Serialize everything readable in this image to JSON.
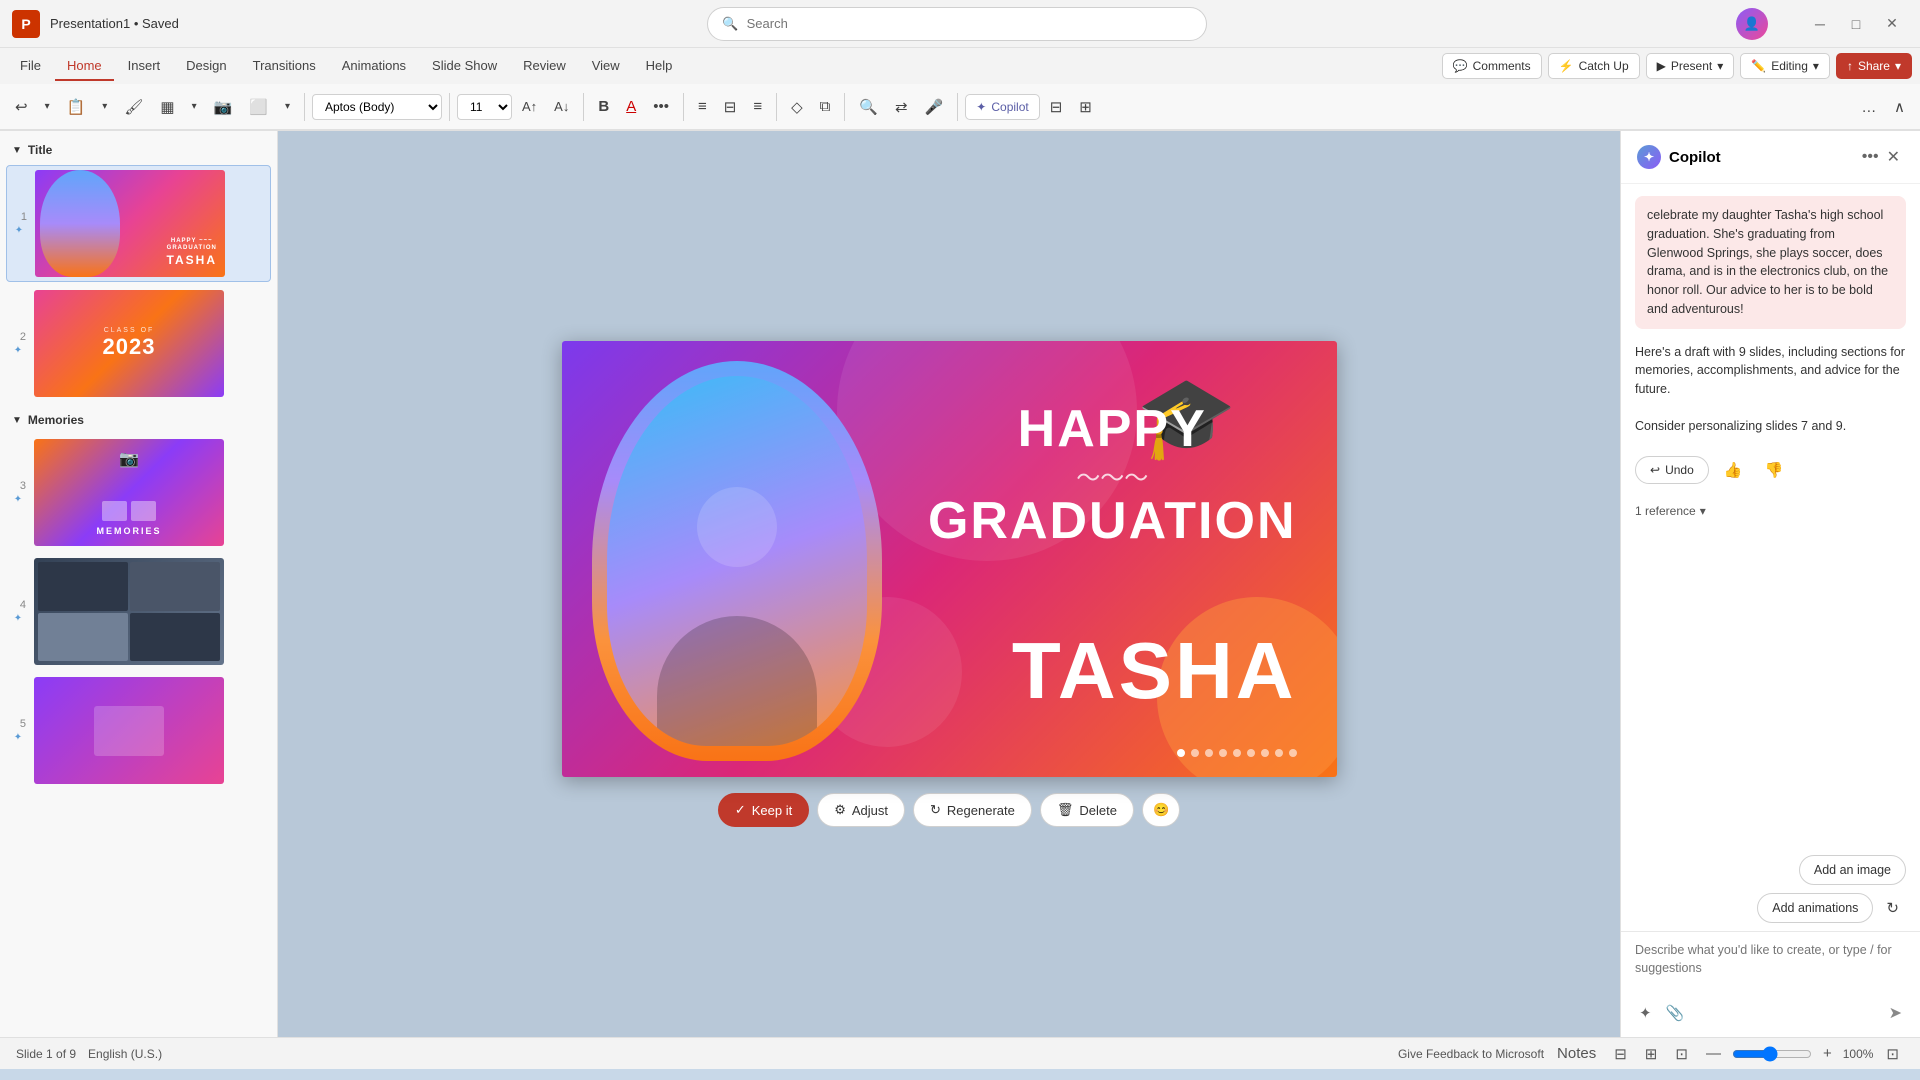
{
  "titlebar": {
    "logo": "P",
    "title": "Presentation1 • Saved",
    "search_placeholder": "Search"
  },
  "ribbon": {
    "tabs": [
      "File",
      "Home",
      "Insert",
      "Design",
      "Transitions",
      "Animations",
      "Slide Show",
      "Review",
      "View",
      "Help"
    ],
    "active_tab": "Home",
    "actions": {
      "comments": "Comments",
      "catch_up": "Catch Up",
      "present": "Present",
      "editing": "Editing",
      "share": "Share",
      "copilot": "Copilot"
    },
    "toolbar": {
      "font": "Aptos (Body)",
      "font_size": "11",
      "bold": "B",
      "more": "..."
    }
  },
  "slide_panel": {
    "sections": [
      {
        "name": "Title",
        "slides": [
          {
            "num": "1",
            "type": "title",
            "label": "HAPPY GRADUATION\nTASHA"
          },
          {
            "num": "2",
            "type": "class2023",
            "label": "CLASS OF\n2023"
          }
        ]
      },
      {
        "name": "Memories",
        "slides": [
          {
            "num": "3",
            "type": "memories",
            "label": "MEMORIES"
          },
          {
            "num": "4",
            "type": "photos"
          },
          {
            "num": "5",
            "type": "group"
          }
        ]
      }
    ]
  },
  "canvas": {
    "slide": {
      "happy": "HAPPY",
      "graduation": "GRADUATION",
      "name": "TASHA"
    }
  },
  "bottom_toolbar": {
    "keep": "Keep it",
    "adjust": "Adjust",
    "regenerate": "Regenerate",
    "delete": "Delete"
  },
  "copilot": {
    "title": "Copilot",
    "ai_message": "celebrate my daughter Tasha's high school graduation. She's graduating from Glenwood Springs, she plays soccer, does drama, and is in the electronics club, on the honor roll. Our advice to her is to be bold and adventurous!",
    "response_text": "Here's a draft with 9 slides, including sections for memories, accomplishments, and advice for the future.",
    "personalize_text": "Consider personalizing slides 7 and 9.",
    "undo": "Undo",
    "reference": "1 reference",
    "add_image": "Add an image",
    "add_animations": "Add animations",
    "input_placeholder": "Describe what you'd like to create, or type / for suggestions"
  },
  "statusbar": {
    "slide_info": "Slide 1 of 9",
    "language": "English (U.S.)",
    "feedback": "Give Feedback to Microsoft",
    "notes": "Notes",
    "zoom": "100%"
  }
}
